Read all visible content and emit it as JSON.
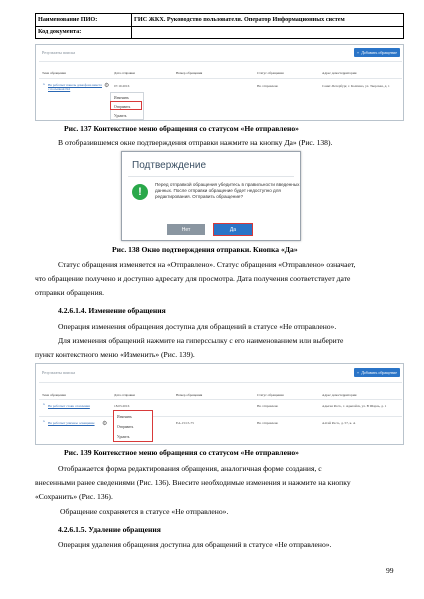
{
  "header": {
    "name_label": "Наименование ПИО:",
    "doc_title": "ГИС ЖКХ. Руководство пользователя. Оператор Информационных систем",
    "code_label": "Код документа:"
  },
  "fig137": {
    "results_title": "Результаты поиска",
    "add_button": "Добавить обращение",
    "columns": [
      "Тема обращения",
      "Дата отправки",
      "Номер обращения",
      "Статус обращения",
      "Адрес дома/территории"
    ],
    "row": {
      "topic": "Не работает панель домофона вместе с посылкой №2",
      "date": "07.10.2016",
      "number": "",
      "status": "Не отправлено",
      "address": "Санкт-Петербург, г. Колпино, ул. Тверская, д. 1"
    },
    "menu": [
      "Изменить",
      "Отправить",
      "Удалить"
    ],
    "caption": "Рис. 137 Контекстное меню обращения со статусом «Не отправлено»"
  },
  "para1": "В отобразившемся окне подтверждения отправки нажмите на кнопку Да» (Рис. 138).",
  "fig138": {
    "title": "Подтверждение",
    "message": "Перед отправкой обращения убедитесь в правильности введенных данных. После отправки обращение будет недоступно для редактирования. Отправить обращение?",
    "message_lines": [
      "Перед отправкой обращения убедитесь в правильности введенных",
      "данных. После отправки обращение будет недоступно для",
      "редактирования. Отправить обращение?"
    ],
    "no_button": "Нет",
    "yes_button": "Да",
    "caption": "Рис. 138 Окно подтверждения отправки. Кнопка «Да»"
  },
  "para2": {
    "lines": [
      "Статус обращения изменяется на «Отправлено». Статус обращения «Отправлено» означает,",
      "что обращение получено и доступно адресату для просмотра. Дата получения соответствует дате",
      "отправки обращения."
    ]
  },
  "section_4_2_6_1_4": {
    "heading": "4.2.6.1.4. Изменение обращения",
    "lines": [
      "Операция изменения обращения доступна для обращений в статусе «Не отправлено».",
      "Для изменения обращений нажмите на гиперссылку с его наименованием или выберите",
      "пункт контекстного меню «Изменить» (Рис. 139)."
    ]
  },
  "fig139": {
    "results_title": "Результаты поиска",
    "add_button": "Добавить обращение",
    "columns": [
      "Тема обращения",
      "Дата отправки",
      "Номер обращения",
      "Статус обращения",
      "Адрес дома/территории"
    ],
    "rows": [
      {
        "topic": "Не работает стояк отопления",
        "date": "18.03.2016",
        "number": "",
        "status": "Не отправлено",
        "address": "Адыгея Респ., г. Адыгейск, ул. В Шарль, д. 1"
      },
      {
        "topic": "Не работает уличное освещение",
        "date": "",
        "number": "EA-15/15-75",
        "status": "Не отправлено",
        "address": "Алтай Респ., д. 57, к. А"
      }
    ],
    "menu": [
      "Изменить",
      "Отправить",
      "Удалить"
    ],
    "caption": "Рис. 139 Контекстное меню обращения со статусом «Не отправлено»"
  },
  "para3": {
    "lines": [
      "Отображается форма редактирования обращения, аналогичная форме создания, с",
      "внесенными ранее сведениями (Рис. 136). Внесите необходимые изменения и нажмите на кнопку",
      "«Сохранить» (Рис. 136).",
      "Обращение сохраняется в статусе «Не отправлено»."
    ]
  },
  "section_4_2_6_1_5": {
    "heading": "4.2.6.1.5. Удаление обращения",
    "line": "Операция удаления обращения доступна для обращений в статусе «Не отправлено»."
  },
  "page_number": "99",
  "colors": {
    "accent": "#2a74c7",
    "highlight": "#d83a3a"
  }
}
